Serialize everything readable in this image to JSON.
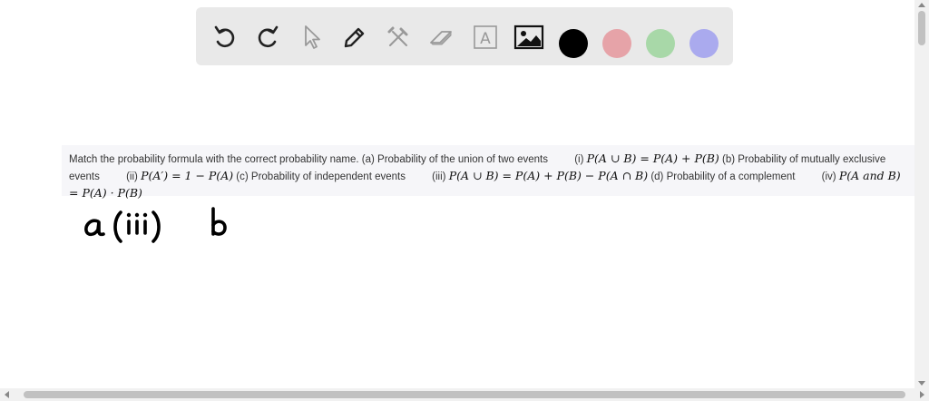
{
  "toolbar": {
    "tools": [
      {
        "name": "undo-icon"
      },
      {
        "name": "redo-icon"
      },
      {
        "name": "pointer-icon"
      },
      {
        "name": "pen-icon"
      },
      {
        "name": "tools-icon"
      },
      {
        "name": "eraser-icon"
      },
      {
        "name": "text-icon",
        "glyph": "A"
      },
      {
        "name": "image-icon"
      }
    ],
    "colors": [
      "#000000",
      "#e6a3a8",
      "#a8d8a8",
      "#aaaaee"
    ]
  },
  "question": {
    "t1": "Match the probability formula with the correct probability name. (a) Probability of the union of two events",
    "m1_label": "(i)",
    "m1": "P(A ∪ B) = P(A) + P(B)",
    "t2": "(b) Probability of mutually exclusive events",
    "m2_label": "(ii)",
    "m2": "P(A′) = 1 − P(A)",
    "t3": "(c) Probability of independent events",
    "m3_label": "(iii)",
    "m3": "P(A ∪ B) = P(A) + P(B) − P(A ∩ B)",
    "t4": "(d) Probability of a complement",
    "m4_label": "(iv)",
    "m4": "P(A and B) = P(A) · P(B)"
  },
  "handwriting": {
    "text": "a (iii)   b"
  }
}
